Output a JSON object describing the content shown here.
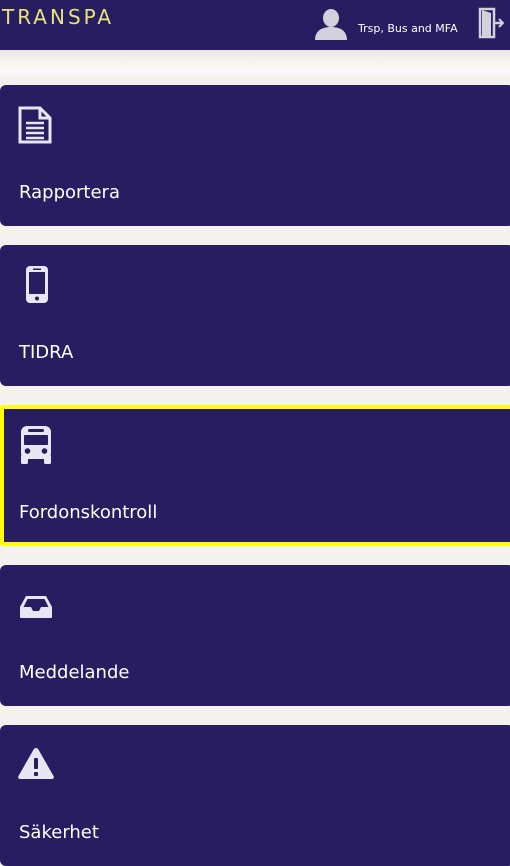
{
  "header": {
    "brand": "TRANSPA",
    "user_name": "Trsp, Bus and MFA",
    "user_icon": "person-icon",
    "logout_icon": "exit-door-icon"
  },
  "menu": {
    "items": [
      {
        "label": "Rapportera",
        "icon": "document-icon",
        "selected": false
      },
      {
        "label": "TIDRA",
        "icon": "mobile-phone-icon",
        "selected": false
      },
      {
        "label": "Fordonskontroll",
        "icon": "bus-icon",
        "selected": true
      },
      {
        "label": "Meddelande",
        "icon": "inbox-icon",
        "selected": false
      },
      {
        "label": "Säkerhet",
        "icon": "warning-icon",
        "selected": false
      }
    ]
  },
  "colors": {
    "header_bg": "#281d60",
    "tile_bg": "#281d60",
    "brand_text": "#e8e37a",
    "selected_border": "#ffff00",
    "page_bg": "#f4f2ef",
    "icon": "#e9e6f3"
  }
}
